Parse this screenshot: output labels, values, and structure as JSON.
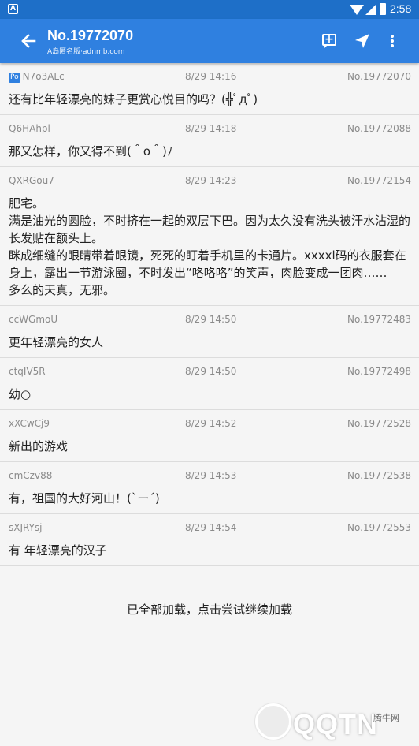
{
  "status_bar": {
    "time": "2:58",
    "notif": "A"
  },
  "app_bar": {
    "title": "No.19772070",
    "subtitle": "A岛匿名版·adnmb.com"
  },
  "badges": {
    "po": "Po"
  },
  "posts": [
    {
      "uid": "N7o3ALc",
      "is_po": true,
      "date": "8/29 14:16",
      "no": "No.19772070",
      "content": "还有比年轻漂亮的妹子更赏心悦目的吗？(╬ﾟдﾟ)"
    },
    {
      "uid": "Q6HAhpl",
      "is_po": false,
      "date": "8/29 14:18",
      "no": "No.19772088",
      "content": "那又怎样，你又得不到(＾o＾)ﾉ"
    },
    {
      "uid": "QXRGou7",
      "is_po": false,
      "date": "8/29 14:23",
      "no": "No.19772154",
      "content": "肥宅。\n满是油光的圆脸，不时挤在一起的双层下巴。因为太久没有洗头被汗水沾湿的长发贴在额头上。\n眯成细缝的眼睛带着眼镜，死死的盯着手机里的卡通片。xxxxl码的衣服套在身上，露出一节游泳圈，不时发出“咯咯咯”的笑声，肉脸变成一团肉……\n多么的天真，无邪。"
    },
    {
      "uid": "ccWGmoU",
      "is_po": false,
      "date": "8/29 14:50",
      "no": "No.19772483",
      "content": "更年轻漂亮的女人"
    },
    {
      "uid": "ctqIV5R",
      "is_po": false,
      "date": "8/29 14:50",
      "no": "No.19772498",
      "content": "幼○"
    },
    {
      "uid": "xXCwCj9",
      "is_po": false,
      "date": "8/29 14:52",
      "no": "No.19772528",
      "content": "新出的游戏"
    },
    {
      "uid": "cmCzv88",
      "is_po": false,
      "date": "8/29 14:53",
      "no": "No.19772538",
      "content": "有，祖国的大好河山！(`ー´)"
    },
    {
      "uid": "sXJRYsj",
      "is_po": false,
      "date": "8/29 14:54",
      "no": "No.19772553",
      "content": "有 年轻漂亮的汉子"
    }
  ],
  "footer": {
    "text": "已全部加载，点击尝试继续加载"
  },
  "watermark": {
    "brand": "QQTN",
    "tag": "腾牛网"
  },
  "colors": {
    "status_bar": "#1e6fc8",
    "app_bar": "#2f80e0",
    "meta": "#8a8a8a",
    "background": "#f5f5f5"
  },
  "icons": {
    "back": "arrow-left-icon",
    "reply": "add-comment-icon",
    "send": "send-icon",
    "more": "more-vert-icon"
  }
}
